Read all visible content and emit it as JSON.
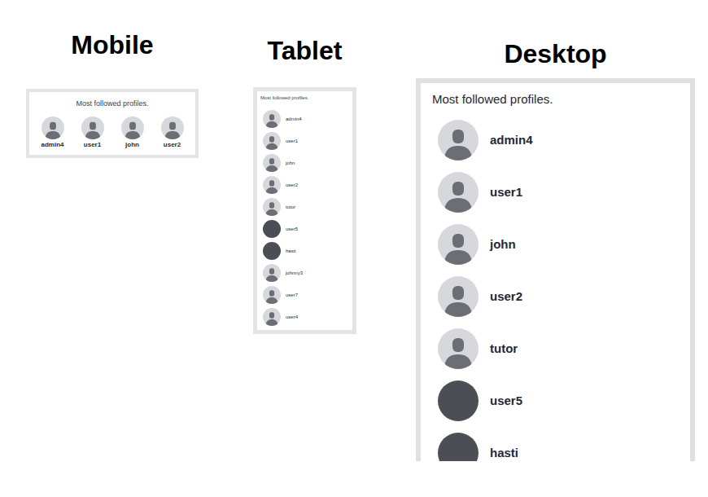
{
  "views": [
    {
      "kind": "mobile",
      "label": "Mobile",
      "title": "Most followed profiles.",
      "profiles": [
        {
          "name": "admin4",
          "kind": "default"
        },
        {
          "name": "user1",
          "kind": "default"
        },
        {
          "name": "john",
          "kind": "default"
        },
        {
          "name": "user2",
          "kind": "default"
        }
      ]
    },
    {
      "kind": "tablet",
      "label": "Tablet",
      "title": "Most followed profiles.",
      "profiles": [
        {
          "name": "admin4",
          "kind": "default"
        },
        {
          "name": "user1",
          "kind": "default"
        },
        {
          "name": "john",
          "kind": "default"
        },
        {
          "name": "user2",
          "kind": "default"
        },
        {
          "name": "tutor",
          "kind": "default"
        },
        {
          "name": "user5",
          "kind": "photo"
        },
        {
          "name": "hasti",
          "kind": "photo"
        },
        {
          "name": "johnny3",
          "kind": "default"
        },
        {
          "name": "user7",
          "kind": "default"
        },
        {
          "name": "user4",
          "kind": "default"
        }
      ]
    },
    {
      "kind": "desktop",
      "label": "Desktop",
      "title": "Most followed profiles.",
      "profiles": [
        {
          "name": "admin4",
          "kind": "default"
        },
        {
          "name": "user1",
          "kind": "default"
        },
        {
          "name": "john",
          "kind": "default"
        },
        {
          "name": "user2",
          "kind": "default"
        },
        {
          "name": "tutor",
          "kind": "default"
        },
        {
          "name": "user5",
          "kind": "photo"
        },
        {
          "name": "hasti",
          "kind": "photo"
        }
      ]
    }
  ]
}
